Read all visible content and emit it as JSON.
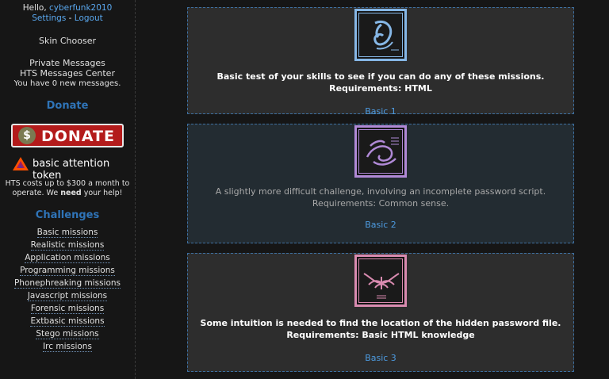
{
  "sidebar": {
    "greeting": "Hello,",
    "username": "cyberfunk2010",
    "settings": "Settings",
    "separator": " - ",
    "logout": "Logout",
    "skin_chooser": "Skin Chooser",
    "private_messages": "Private Messages",
    "messages_center": "HTS Messages Center",
    "new_messages": "You have 0 new messages.",
    "donate_heading": "Donate",
    "donate_button": "DONATE",
    "donate_symbol": "$",
    "bat_text": "basic attention token",
    "cost_line1": "HTS costs up to $300 a month to",
    "cost_line2_a": "operate. We ",
    "cost_line2_b": "need",
    "cost_line2_c": " your help!",
    "challenges_heading": "Challenges",
    "challenges": [
      "Basic missions",
      "Realistic missions",
      "Application missions",
      "Programming missions",
      "Phonephreaking missions",
      "Javascript missions",
      "Forensic missions",
      "Extbasic missions",
      "Stego missions",
      "Irc missions"
    ]
  },
  "missions": [
    {
      "description": "Basic test of your skills to see if you can do any of these missions. Requirements: HTML",
      "link": "Basic 1",
      "color": "#86b7e6"
    },
    {
      "description": "A slightly more difficult challenge, involving an incomplete password script. Requirements: Common sense.",
      "link": "Basic 2",
      "color": "#b089d6"
    },
    {
      "description": "Some intuition is needed to find the location of the hidden password file. Requirements: Basic HTML knowledge",
      "link": "Basic 3",
      "color": "#d98bb0"
    }
  ]
}
